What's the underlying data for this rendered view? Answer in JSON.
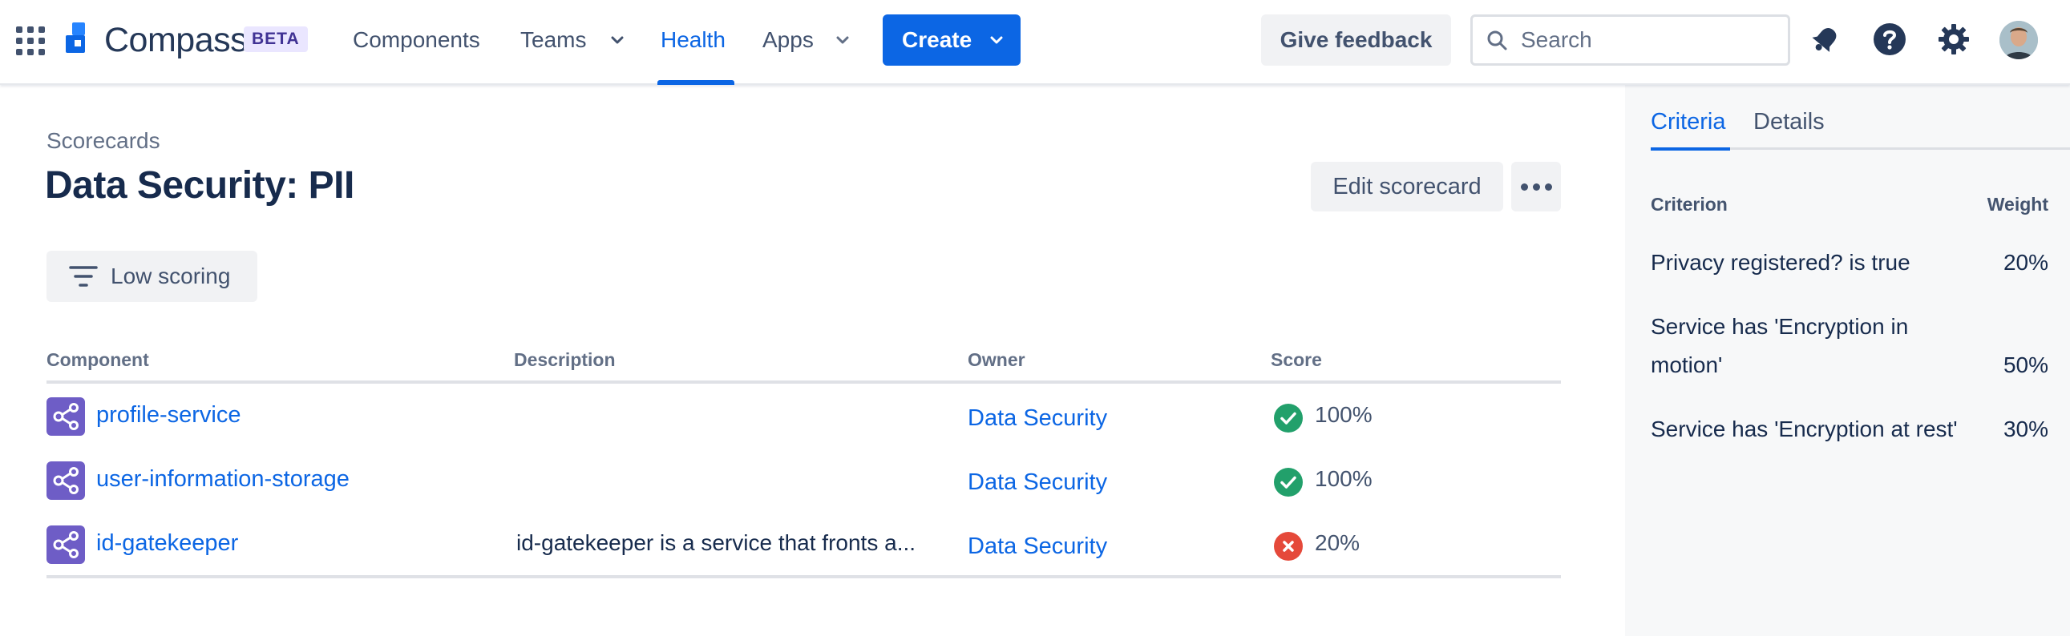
{
  "nav": {
    "product": "Compass",
    "badge": "BETA",
    "items": [
      {
        "label": "Components"
      },
      {
        "label": "Teams"
      },
      {
        "label": "Health"
      },
      {
        "label": "Apps"
      }
    ],
    "active_item": "Health",
    "create_label": "Create",
    "feedback_label": "Give feedback",
    "search_placeholder": "Search",
    "icons": [
      "app-switcher-icon",
      "notifications-icon",
      "help-icon",
      "settings-icon",
      "avatar"
    ]
  },
  "page": {
    "breadcrumb": "Scorecards",
    "title": "Data Security: PII",
    "edit_label": "Edit scorecard",
    "filter_label": "Low scoring"
  },
  "table": {
    "headers": {
      "component": "Component",
      "description": "Description",
      "owner": "Owner",
      "score": "Score"
    },
    "rows": [
      {
        "component": "profile-service",
        "description": "",
        "owner": "Data Security",
        "score": "100%",
        "status": "pass"
      },
      {
        "component": "user-information-storage",
        "description": "",
        "owner": "Data Security",
        "score": "100%",
        "status": "pass"
      },
      {
        "component": "id-gatekeeper",
        "description": "id-gatekeeper is a service that fronts a...",
        "owner": "Data Security",
        "score": "20%",
        "status": "fail"
      }
    ]
  },
  "panel": {
    "tabs": [
      "Criteria",
      "Details"
    ],
    "active_tab": "Criteria",
    "headers": {
      "criterion": "Criterion",
      "weight": "Weight"
    },
    "criteria": [
      {
        "text": "Privacy registered? is true",
        "weight": "20%"
      },
      {
        "text": "Service has 'Encryption in motion'",
        "weight": "50%"
      },
      {
        "text": "Service has 'Encryption at rest'",
        "weight": "30%"
      }
    ]
  },
  "colors": {
    "brand_blue": "#0c66e4",
    "component_icon": "#6e5dc6",
    "pass_green": "#22a06b",
    "fail_red": "#e5493a"
  }
}
